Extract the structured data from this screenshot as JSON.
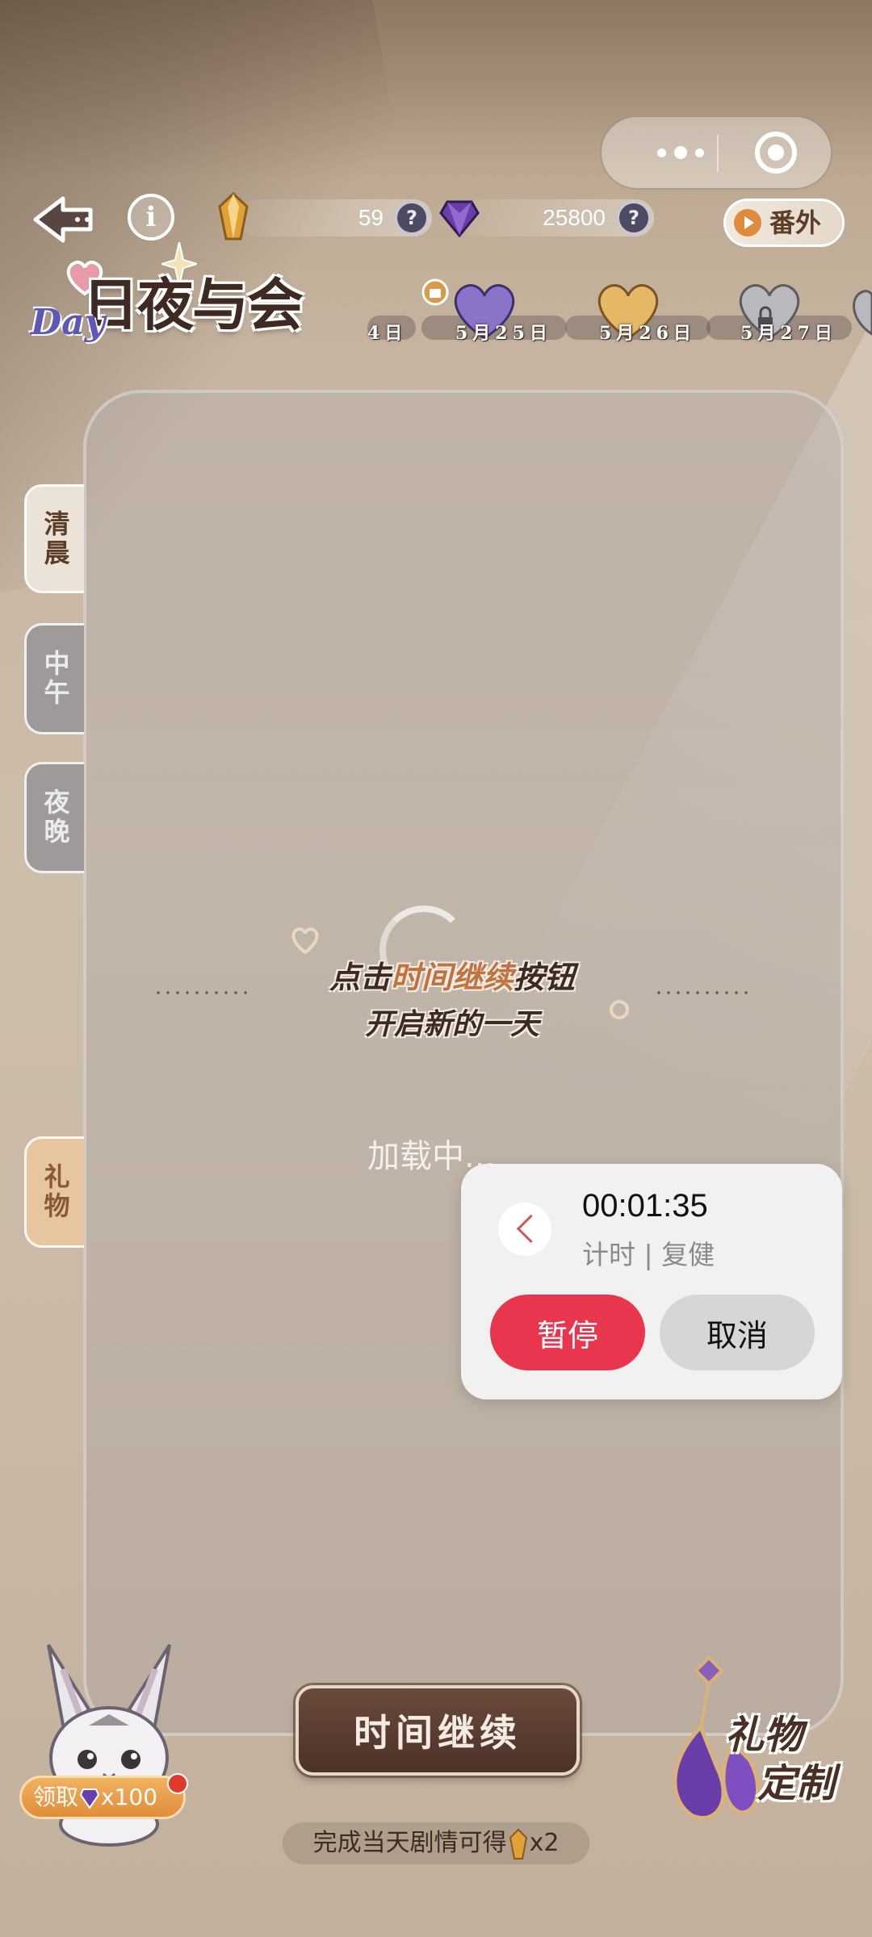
{
  "header": {
    "currency_gold": {
      "amount": "59",
      "help": "?"
    },
    "currency_purple": {
      "amount": "25800",
      "help": "?"
    },
    "fanwai_label": "番外",
    "info_label": "i"
  },
  "logo": {
    "title": "日夜与会",
    "day": "Day"
  },
  "date_tabs": [
    {
      "label": "4日",
      "state": "partial"
    },
    {
      "label": "5月25日",
      "state": "gift-purple"
    },
    {
      "label": "5月26日",
      "state": "gold"
    },
    {
      "label": "5月27日",
      "state": "locked"
    }
  ],
  "side_tabs": [
    {
      "label": "清晨",
      "state": "active"
    },
    {
      "label": "中午",
      "state": "inactive"
    },
    {
      "label": "夜晚",
      "state": "inactive"
    },
    {
      "label": "礼物",
      "state": "gift"
    }
  ],
  "prompt": {
    "line1_pre": "点击",
    "line1_highlight": "时间继续",
    "line1_post": "按钮",
    "line2": "开启新的一天"
  },
  "loading_text": "加载中...",
  "timer": {
    "time": "00:01:35",
    "subtitle": "计时 | 复健",
    "pause_label": "暂停",
    "cancel_label": "取消"
  },
  "bottom": {
    "main_button": "时间继续",
    "hint": "完成当天剧情可得",
    "hint_reward": "x2",
    "claim_label": "领取",
    "claim_amount": "x100",
    "gift_custom_1": "礼物",
    "gift_custom_2": "定制"
  },
  "colors": {
    "accent_pause": "#e8364f",
    "text_dark": "#3d2a22",
    "highlight": "#c0733f",
    "purple_gem": "#6a3ea8",
    "gold_gem": "#e0a236"
  }
}
